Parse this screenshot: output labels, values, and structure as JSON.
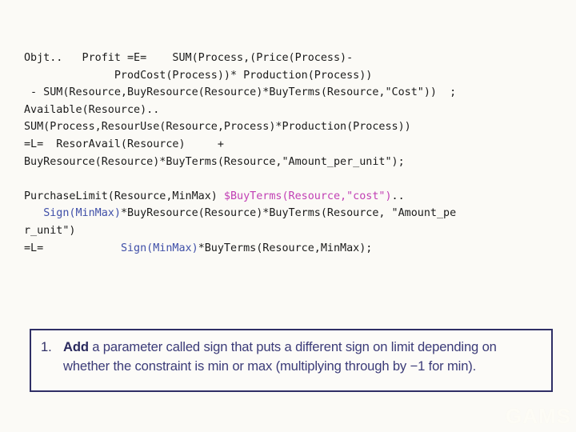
{
  "slide": {
    "background_color": "#fbfaf6",
    "code_text_color": "#1b1b1b",
    "accent_magenta": "#c13fb4",
    "accent_blue": "#3f4fa8",
    "callout_border_color": "#2f2f66",
    "callout_text_color": "#3b3b78"
  },
  "code": {
    "lines": [
      {
        "id": "line-objective-1",
        "segments": [
          {
            "text": "Objt..   Profit =E=    SUM(Process,(Price(Process)-",
            "color": "plain"
          }
        ]
      },
      {
        "id": "line-objective-2",
        "segments": [
          {
            "text": "              ProdCost(Process))* Production(Process))",
            "color": "plain"
          }
        ]
      },
      {
        "id": "line-objective-3",
        "segments": [
          {
            "text": " - SUM(Resource,BuyResource(Resource)*BuyTerms(Resource,\"Cost\"))  ;",
            "color": "plain"
          }
        ]
      },
      {
        "id": "line-available-1",
        "segments": [
          {
            "text": "Available(Resource)..",
            "color": "plain"
          }
        ]
      },
      {
        "id": "line-available-2",
        "segments": [
          {
            "text": "SUM(Process,ResourUse(Resource,Process)*Production(Process))",
            "color": "plain"
          }
        ]
      },
      {
        "id": "line-available-3",
        "segments": [
          {
            "text": "=L=  ResorAvail(Resource)     +",
            "color": "plain"
          }
        ]
      },
      {
        "id": "line-available-4",
        "segments": [
          {
            "text": "BuyResource(Resource)*BuyTerms(Resource,\"Amount_per_unit\");",
            "color": "plain"
          }
        ]
      },
      {
        "id": "line-blank-1",
        "segments": []
      },
      {
        "id": "line-purchaselimit-1",
        "segments": [
          {
            "text": "PurchaseLimit(Resource,MinMax) ",
            "color": "plain"
          },
          {
            "text": "$BuyTerms(Resource,\"cost\")",
            "color": "magenta"
          },
          {
            "text": "..",
            "color": "plain"
          }
        ]
      },
      {
        "id": "line-purchaselimit-2",
        "segments": [
          {
            "text": "   ",
            "color": "plain"
          },
          {
            "text": "Sign(MinMax)",
            "color": "blue"
          },
          {
            "text": "*BuyResource(Resource)*BuyTerms(Resource, \"Amount_pe",
            "color": "plain"
          }
        ]
      },
      {
        "id": "line-purchaselimit-3",
        "segments": [
          {
            "text": "r_unit\")",
            "color": "plain"
          }
        ]
      },
      {
        "id": "line-purchaselimit-4",
        "segments": [
          {
            "text": "=L=            ",
            "color": "plain"
          },
          {
            "text": "Sign(MinMax)",
            "color": "blue"
          },
          {
            "text": "*BuyTerms(Resource,MinMax);",
            "color": "plain"
          }
        ]
      }
    ]
  },
  "callout": {
    "marker": "1.",
    "text_parts": [
      {
        "text": "Add",
        "bold": true
      },
      {
        "text": " a parameter called sign that puts a different sign on limit depending on whether the constraint is min or max (multiplying through by −1 for min).",
        "bold": false
      }
    ],
    "full_text": "Add a parameter called sign that puts a different sign on limit depending on whether the constraint is min or max (multiplying through by −1 for min)."
  },
  "watermark": {
    "text": "GAMS"
  }
}
